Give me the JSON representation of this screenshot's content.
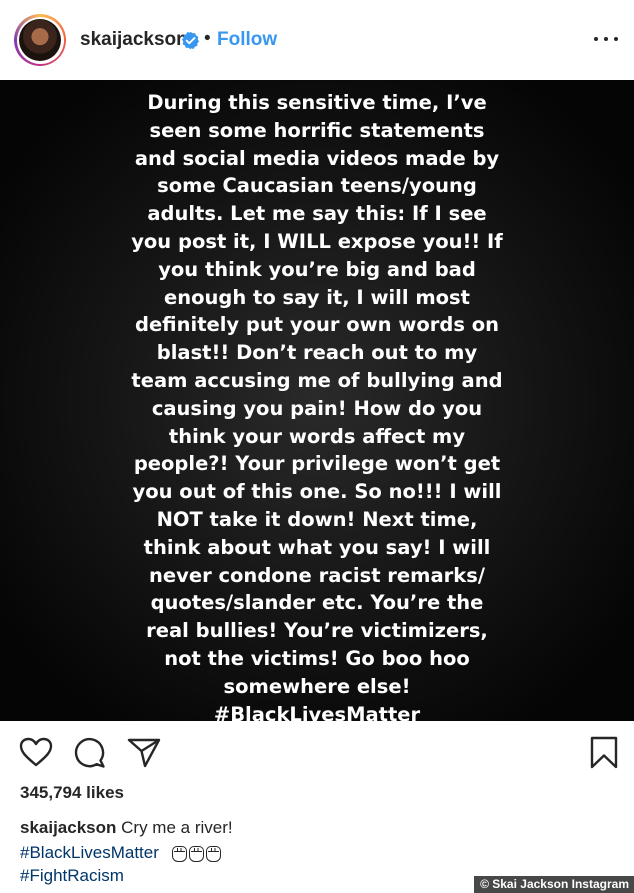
{
  "header": {
    "username": "skaijackson",
    "separator": "•",
    "follow_label": "Follow"
  },
  "story": {
    "lines": [
      "During this sensitive time, I’ve",
      "seen some horrific statements",
      "and social media videos made by",
      "some Caucasian teens/young",
      "adults. Let me say this: If I see",
      "you post it, I WILL expose you!! If",
      "you think you’re big and bad",
      "enough to say it, I will most",
      "definitely put your own words on",
      "blast!! Don’t reach out to my",
      "team accusing me of bullying and",
      "causing you pain! How do you",
      "think your words affect my",
      "people?! Your privilege won’t get",
      "you out of this one. So no!!! I will",
      "NOT take it down! Next time,",
      "think about what you say! I will",
      "never condone racist remarks/",
      "quotes/slander etc. You’re the",
      "real bullies! You’re victimizers,",
      "not the victims! Go boo hoo",
      "somewhere else!"
    ],
    "hashtag": "#BlackLivesMatter"
  },
  "engagement": {
    "likes": "345,794 likes"
  },
  "caption": {
    "username": "skaijackson",
    "text": "Cry me a river!",
    "hashtags": [
      "#BlackLivesMatter",
      "#FightRacism"
    ],
    "emoji": "raised-fist-icon"
  },
  "credit": "© Skai Jackson Instagram",
  "colors": {
    "follow": "#3897f0",
    "hashtag": "#003569",
    "verified": "#3897f0"
  }
}
